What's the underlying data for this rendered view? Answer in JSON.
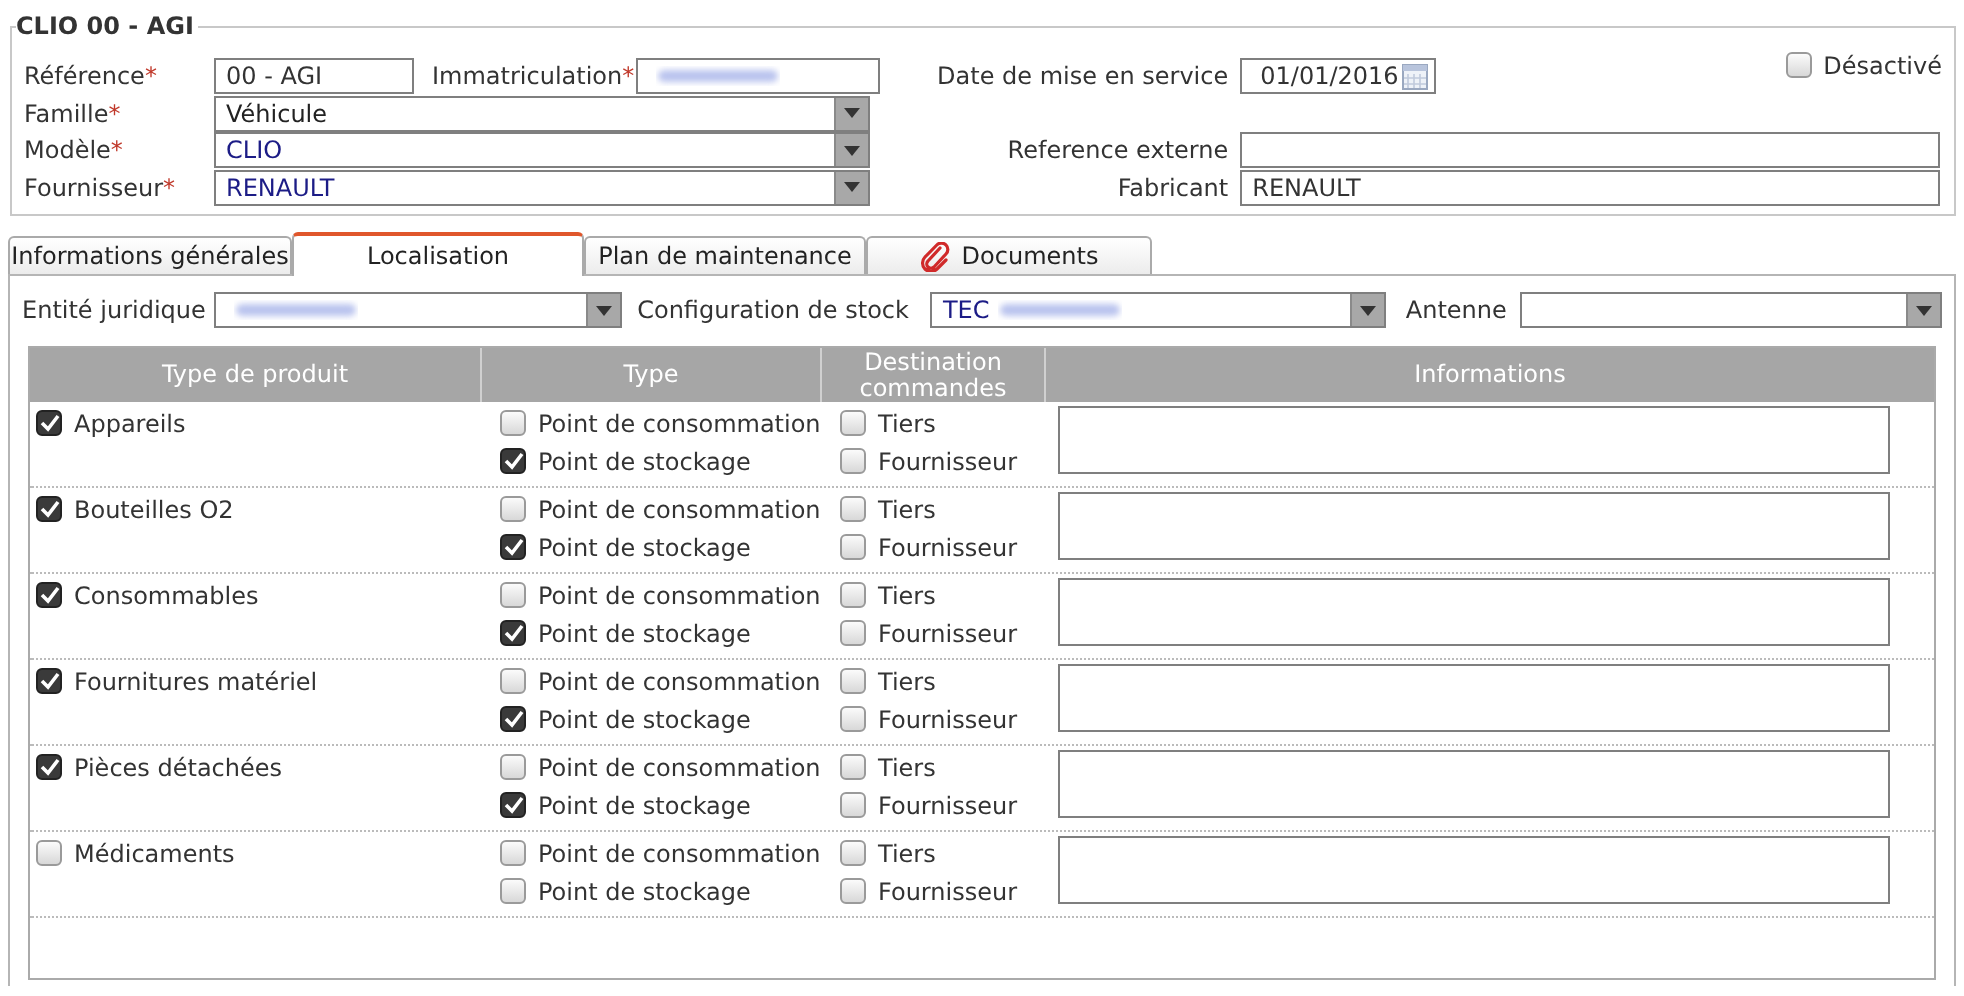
{
  "header": {
    "title": "CLIO 00 - AGI",
    "reference": {
      "label": "Référence",
      "required_mark": "*",
      "value": "00 - AGI"
    },
    "immatriculation": {
      "label": "Immatriculation",
      "required_mark": "*",
      "redacted": true
    },
    "famille": {
      "label": "Famille",
      "required_mark": "*",
      "value": "Véhicule",
      "link": false
    },
    "modele": {
      "label": "Modèle",
      "required_mark": "*",
      "value": "CLIO",
      "link": true
    },
    "fournisseur": {
      "label": "Fournisseur",
      "required_mark": "*",
      "value": "RENAULT",
      "link": true
    },
    "date_mise_en_service": {
      "label": "Date de mise en service",
      "value": "01/01/2016"
    },
    "desactive": {
      "label": "Désactivé",
      "checked": false
    },
    "reference_externe": {
      "label": "Reference externe"
    },
    "fabricant": {
      "label": "Fabricant",
      "value": "RENAULT"
    }
  },
  "tabs": [
    {
      "label": "Informations générales",
      "selected": false,
      "kind": "plain"
    },
    {
      "label": "Localisation",
      "selected": true,
      "kind": "plain"
    },
    {
      "label": "Plan de maintenance",
      "selected": false,
      "kind": "plain"
    },
    {
      "label": "Documents",
      "selected": false,
      "kind": "attachment"
    }
  ],
  "localisation": {
    "entite_juridique": {
      "label": "Entité juridique",
      "redacted": true
    },
    "configuration_stock": {
      "label": "Configuration de stock",
      "value": "TEC",
      "redacted": true,
      "link": true
    },
    "antenne": {
      "label": "Antenne"
    },
    "table": {
      "columns": [
        "Type de produit",
        "Type",
        "Destination commandes",
        "Informations"
      ],
      "rows": [
        {
          "product": "Appareils",
          "checked": true,
          "types": [
            {
              "label": "Point de consommation",
              "checked": false
            },
            {
              "label": "Point de stockage",
              "checked": true
            }
          ],
          "destinations": [
            {
              "label": "Tiers",
              "checked": false
            },
            {
              "label": "Fournisseur",
              "checked": false
            }
          ]
        },
        {
          "product": "Bouteilles O2",
          "checked": true,
          "types": [
            {
              "label": "Point de consommation",
              "checked": false
            },
            {
              "label": "Point de stockage",
              "checked": true
            }
          ],
          "destinations": [
            {
              "label": "Tiers",
              "checked": false
            },
            {
              "label": "Fournisseur",
              "checked": false
            }
          ]
        },
        {
          "product": "Consommables",
          "checked": true,
          "types": [
            {
              "label": "Point de consommation",
              "checked": false
            },
            {
              "label": "Point de stockage",
              "checked": true
            }
          ],
          "destinations": [
            {
              "label": "Tiers",
              "checked": false
            },
            {
              "label": "Fournisseur",
              "checked": false
            }
          ]
        },
        {
          "product": "Fournitures matériel",
          "checked": true,
          "types": [
            {
              "label": "Point de consommation",
              "checked": false
            },
            {
              "label": "Point de stockage",
              "checked": true
            }
          ],
          "destinations": [
            {
              "label": "Tiers",
              "checked": false
            },
            {
              "label": "Fournisseur",
              "checked": false
            }
          ]
        },
        {
          "product": "Pièces détachées",
          "checked": true,
          "types": [
            {
              "label": "Point de consommation",
              "checked": false
            },
            {
              "label": "Point de stockage",
              "checked": true
            }
          ],
          "destinations": [
            {
              "label": "Tiers",
              "checked": false
            },
            {
              "label": "Fournisseur",
              "checked": false
            }
          ]
        },
        {
          "product": "Médicaments",
          "checked": false,
          "types": [
            {
              "label": "Point de consommation",
              "checked": false
            },
            {
              "label": "Point de stockage",
              "checked": false
            }
          ],
          "destinations": [
            {
              "label": "Tiers",
              "checked": false
            },
            {
              "label": "Fournisseur",
              "checked": false
            }
          ]
        }
      ]
    }
  }
}
